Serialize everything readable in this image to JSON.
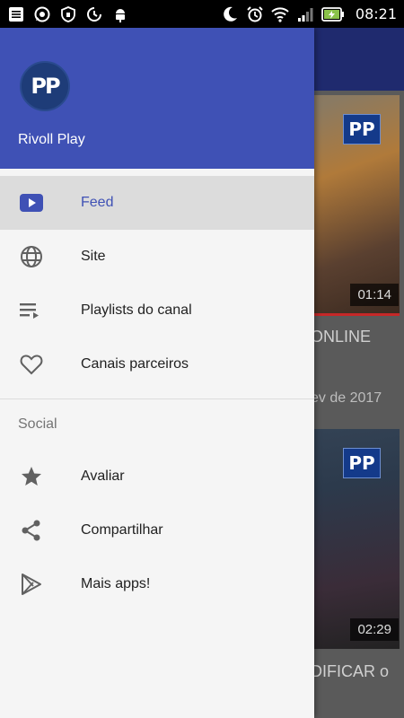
{
  "status_bar": {
    "time": "08:21",
    "icons_left": [
      "notes-icon",
      "whatsapp-icon",
      "shield-icon",
      "data-saver-icon",
      "android-icon"
    ],
    "icons_right": [
      "moon-icon",
      "alarm-icon",
      "wifi-icon",
      "signal-icon",
      "battery-charging-icon"
    ]
  },
  "drawer": {
    "header": {
      "avatar_text": "PP",
      "app_name": "Rivoll Play",
      "background_color": "#3f51b5"
    },
    "primary_items": [
      {
        "label": "Feed",
        "icon": "youtube-play-icon",
        "active": true
      },
      {
        "label": "Site",
        "icon": "globe-icon",
        "active": false
      },
      {
        "label": "Playlists do canal",
        "icon": "playlist-icon",
        "active": false
      },
      {
        "label": "Canais parceiros",
        "icon": "heart-icon",
        "active": false
      }
    ],
    "section_title": "Social",
    "secondary_items": [
      {
        "label": "Avaliar",
        "icon": "star-icon"
      },
      {
        "label": "Compartilhar",
        "icon": "share-icon"
      },
      {
        "label": "Mais apps!",
        "icon": "play-store-icon"
      }
    ]
  },
  "background_feed": {
    "cards": [
      {
        "logo_text": "PP",
        "duration": "01:14",
        "title_fragment": "ONLINE",
        "date_fragment": "ev de 2017"
      },
      {
        "logo_text": "PP",
        "duration": "02:29",
        "title_fragment": "DIFICAR o"
      }
    ]
  }
}
